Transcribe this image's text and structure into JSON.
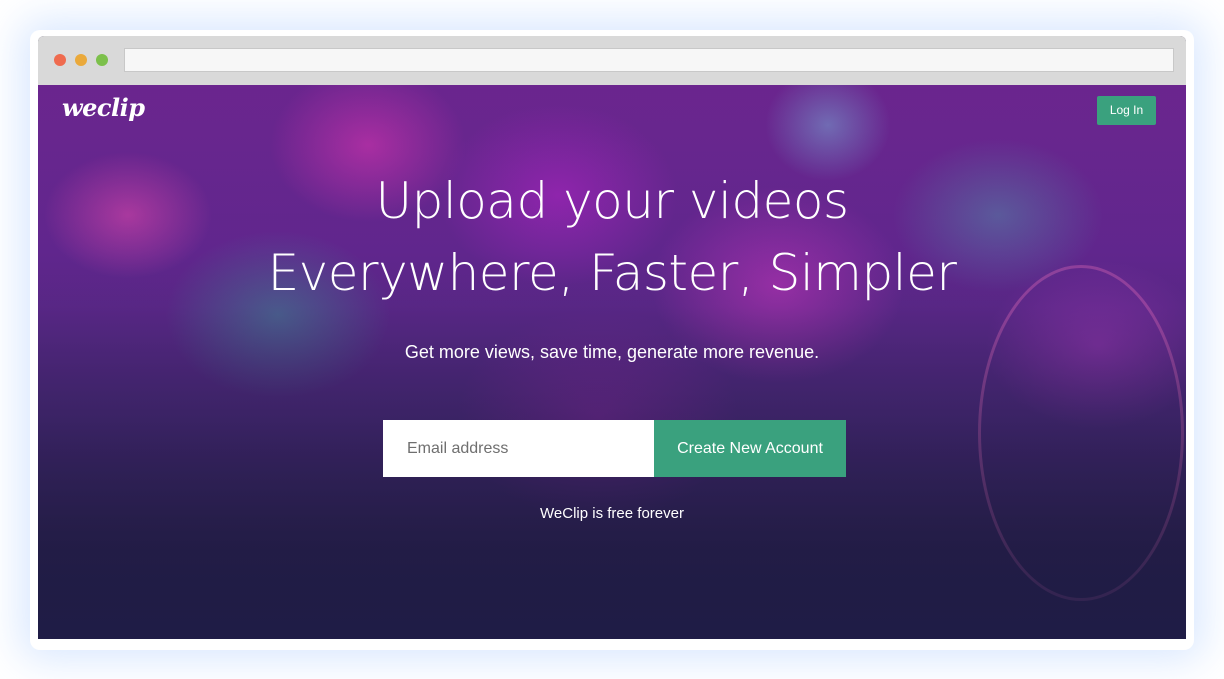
{
  "browser": {
    "url": ""
  },
  "header": {
    "logo_text": "weclip",
    "login_label": "Log In"
  },
  "hero": {
    "headline_line1": "Upload your videos",
    "headline_line2": "Everywhere, Faster, Simpler",
    "subheadline": "Get more views, save time, generate more revenue.",
    "email_placeholder": "Email address",
    "email_value": "",
    "cta_label": "Create New Account",
    "footnote": "WeClip is free forever"
  },
  "colors": {
    "accent_green": "#3aa17e",
    "hero_purple": "#6a2a9a",
    "hero_bottom": "#241f46"
  }
}
